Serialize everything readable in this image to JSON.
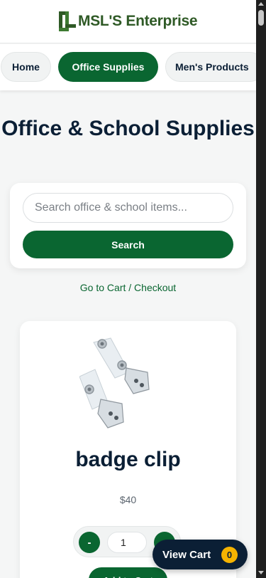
{
  "brand": {
    "name": "MSL'S Enterprise",
    "color": "#2f5a26"
  },
  "nav": {
    "items": [
      {
        "label": "Home",
        "active": false
      },
      {
        "label": "Office Supplies",
        "active": true
      },
      {
        "label": "Men's Products",
        "active": false
      }
    ]
  },
  "page": {
    "title": "Office & School Supplies"
  },
  "search": {
    "placeholder": "Search office & school items...",
    "value": "",
    "button_label": "Search"
  },
  "cart_link": "Go to Cart / Checkout",
  "products": [
    {
      "name": "badge clip",
      "price": "$40",
      "quantity": "1",
      "minus_label": "-",
      "plus_label": "+",
      "add_label": "Add to Cart"
    }
  ],
  "floating_cart": {
    "label": "View Cart",
    "count": "0"
  },
  "colors": {
    "accent": "#0a6631",
    "navy": "#0b1f35",
    "badge": "#f5b301"
  }
}
